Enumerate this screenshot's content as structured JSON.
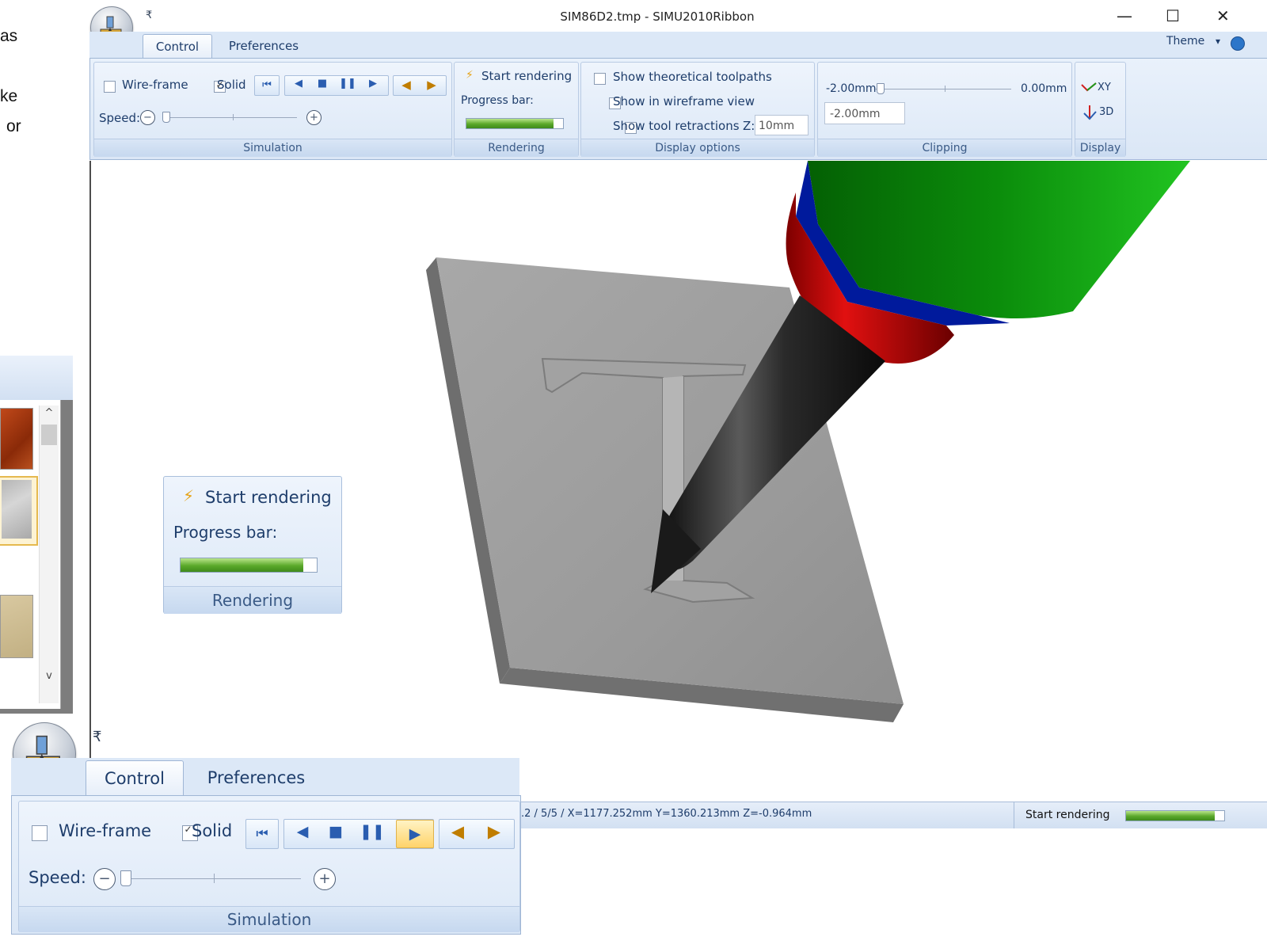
{
  "stray_text": {
    "line1": "as",
    "line2": "ke",
    "line3": "or"
  },
  "window": {
    "title": "SIM86D2.tmp - SIMU2010Ribbon",
    "qat_glyph": "₹",
    "minimize": "—",
    "maximize": "☐",
    "close": "✕"
  },
  "tabs": {
    "control": "Control",
    "preferences": "Preferences",
    "theme": "Theme",
    "theme_arrow": "▾"
  },
  "simulation": {
    "wireframe_label": "Wire-frame",
    "wireframe_checked": false,
    "solid_label": "Solid",
    "solid_checked": true,
    "speed_label": "Speed:",
    "minus": "−",
    "plus": "+",
    "group_label": "Simulation",
    "buttons": {
      "reset": "⏮",
      "step_back": "◀",
      "stop": "■",
      "pause": "❚❚",
      "play": "▶",
      "prev": "◀",
      "next": "▶"
    }
  },
  "rendering": {
    "start_label": "Start rendering",
    "bolt": "⚡",
    "progress_label": "Progress bar:",
    "progress": 0.9,
    "group_label": "Rendering"
  },
  "display_options": {
    "theoretical": "Show theoretical toolpaths",
    "wireframe_view": "Show in wireframe view",
    "retractions": "Show tool retractions",
    "z_label": "Z:",
    "z_value": "10mm",
    "group_label": "Display options"
  },
  "clipping": {
    "min_label": "-2.00mm",
    "max_label": "0.00mm",
    "field_value": "-2.00mm",
    "group_label": "Clipping"
  },
  "display": {
    "xy": "XY",
    "three_d": "3D",
    "group_label": "Display"
  },
  "statusbar": {
    "info": ".2 / 5/5 / X=1177.252mm Y=1360.213mm Z=-0.964mm",
    "render_label": "Start rendering",
    "progress": 0.9
  },
  "scroll": {
    "up": "^",
    "down": "v"
  },
  "colors": {
    "tool_body": "#222222",
    "collar_red": "#c40000",
    "ring_blue": "#001a9c",
    "spindle_green": "#0a8a0a",
    "stock_grey": "#9a9a9a"
  }
}
